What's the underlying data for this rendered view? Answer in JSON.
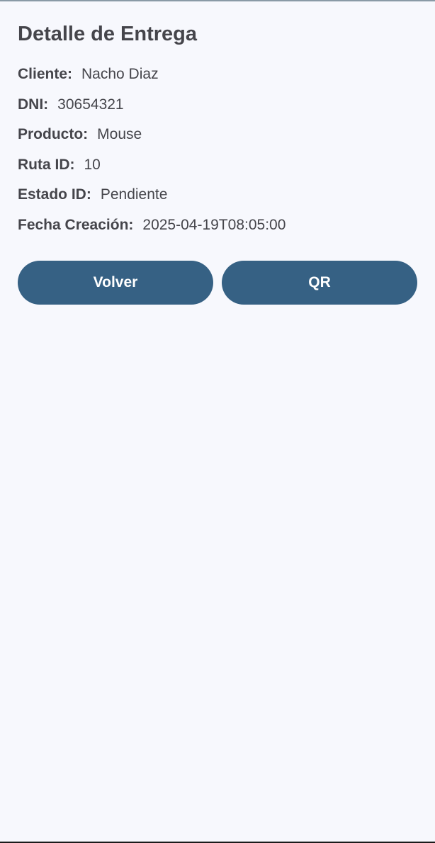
{
  "title": "Detalle de Entrega",
  "details": [
    {
      "label": "Cliente:",
      "value": "Nacho Diaz"
    },
    {
      "label": "DNI:",
      "value": "30654321"
    },
    {
      "label": "Producto:",
      "value": "Mouse"
    },
    {
      "label": "Ruta ID:",
      "value": "10"
    },
    {
      "label": "Estado ID:",
      "value": "Pendiente"
    },
    {
      "label": "Fecha Creación:",
      "value": "2025-04-19T08:05:00"
    }
  ],
  "buttons": {
    "back_label": "Volver",
    "qr_label": "QR"
  },
  "colors": {
    "background": "#f7f8fd",
    "button": "#366184",
    "button_text": "#ffffff",
    "text": "#45454b"
  }
}
